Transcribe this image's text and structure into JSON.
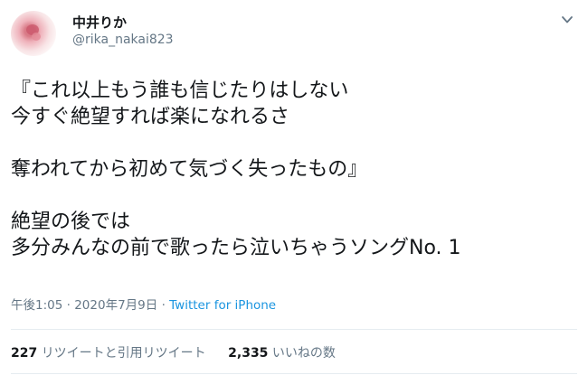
{
  "user": {
    "display_name": "中井りか",
    "username": "@rika_nakai823",
    "avatar_icon": "avatar-flower-photo"
  },
  "tweet": {
    "lines": [
      "『これ以上もう誰も信じたりはしない",
      "今すぐ絶望すれば楽になれるさ",
      "",
      "奪われてから初めて気づく失ったもの』",
      "",
      "絶望の後では",
      "多分みんなの前で歌ったら泣いちゃうソングNo. 1"
    ]
  },
  "meta": {
    "time": "午後1:05",
    "separator": "·",
    "date": "2020年7月9日",
    "source": "Twitter for iPhone"
  },
  "stats": {
    "retweets_count": "227",
    "retweets_label": "リツイートと引用リツイート",
    "likes_count": "2,335",
    "likes_label": "いいねの数"
  },
  "colors": {
    "text": "#14171a",
    "secondary": "#657786",
    "link": "#1b95e0",
    "divider": "#e6ecf0"
  },
  "icons": {
    "menu": "chevron-down-icon"
  }
}
